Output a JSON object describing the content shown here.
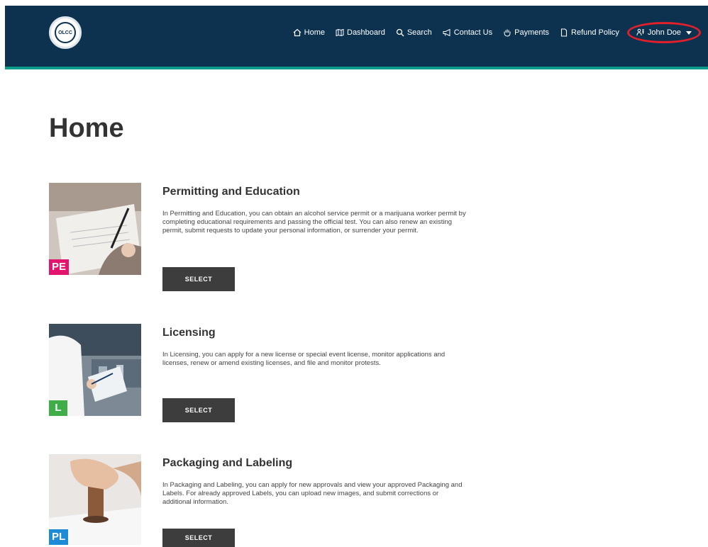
{
  "header": {
    "logo_text": "OLCC",
    "nav": [
      {
        "label": "Home",
        "icon": "home-icon"
      },
      {
        "label": "Dashboard",
        "icon": "map-icon"
      },
      {
        "label": "Search",
        "icon": "search-icon"
      },
      {
        "label": "Contact Us",
        "icon": "megaphone-icon"
      },
      {
        "label": "Payments",
        "icon": "hand-icon"
      },
      {
        "label": "Refund Policy",
        "icon": "document-icon"
      }
    ],
    "user": {
      "name": "John Doe",
      "icon": "user-icon",
      "highlight_color": "#e0202a"
    },
    "background": "#0c3250",
    "accent": "#0e9c8a"
  },
  "page": {
    "title": "Home"
  },
  "cards": [
    {
      "title": "Permitting and Education",
      "badge": "PE",
      "badge_color": "#e3146e",
      "description": "In Permitting and Education, you can obtain an alcohol service permit or a marijuana worker permit by completing educational requirements and passing the official test. You can also renew an existing permit, submit requests to update your personal information, or surrender your permit.",
      "button": "SELECT"
    },
    {
      "title": "Licensing",
      "badge": "L",
      "badge_color": "#3fae49",
      "description": "In Licensing, you can apply for a new license or special event license, monitor applications and licenses, renew or amend existing licenses, and file and monitor protests.",
      "button": "SELECT"
    },
    {
      "title": "Packaging and Labeling",
      "badge": "PL",
      "badge_color": "#1e8bd6",
      "description": "In Packaging and Labeling, you can apply for new approvals and view your approved Packaging and Labels. For already approved Labels, you can upload new images, and submit corrections or additional information.",
      "button": "SELECT"
    }
  ]
}
